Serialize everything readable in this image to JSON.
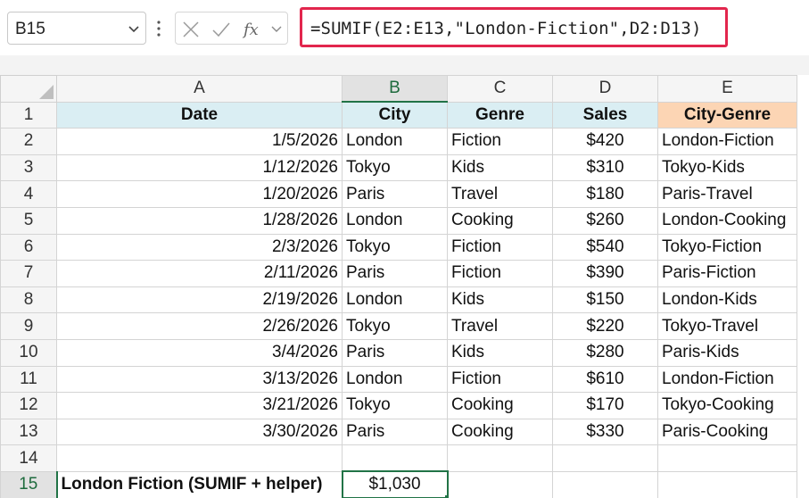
{
  "name_box": {
    "value": "B15"
  },
  "formula_bar": {
    "formula": "=SUMIF(E2:E13,\"London-Fiction\",D2:D13)",
    "highlight_color": "#e2264d",
    "icons": [
      "cancel-icon",
      "enter-check-icon",
      "fx-icon",
      "chevron-down-icon"
    ]
  },
  "columns": [
    "A",
    "B",
    "C",
    "D",
    "E"
  ],
  "active_column": "B",
  "rows": [
    "1",
    "2",
    "3",
    "4",
    "5",
    "6",
    "7",
    "8",
    "9",
    "10",
    "11",
    "12",
    "13",
    "14",
    "15"
  ],
  "active_row": "15",
  "headers": {
    "date": "Date",
    "city": "City",
    "genre": "Genre",
    "sales": "Sales",
    "city_genre": "City-Genre"
  },
  "data": [
    {
      "date": "1/5/2026",
      "city": "London",
      "genre": "Fiction",
      "sales": "$420",
      "city_genre": "London-Fiction"
    },
    {
      "date": "1/12/2026",
      "city": "Tokyo",
      "genre": "Kids",
      "sales": "$310",
      "city_genre": "Tokyo-Kids"
    },
    {
      "date": "1/20/2026",
      "city": "Paris",
      "genre": "Travel",
      "sales": "$180",
      "city_genre": "Paris-Travel"
    },
    {
      "date": "1/28/2026",
      "city": "London",
      "genre": "Cooking",
      "sales": "$260",
      "city_genre": "London-Cooking"
    },
    {
      "date": "2/3/2026",
      "city": "Tokyo",
      "genre": "Fiction",
      "sales": "$540",
      "city_genre": "Tokyo-Fiction"
    },
    {
      "date": "2/11/2026",
      "city": "Paris",
      "genre": "Fiction",
      "sales": "$390",
      "city_genre": "Paris-Fiction"
    },
    {
      "date": "2/19/2026",
      "city": "London",
      "genre": "Kids",
      "sales": "$150",
      "city_genre": "London-Kids"
    },
    {
      "date": "2/26/2026",
      "city": "Tokyo",
      "genre": "Travel",
      "sales": "$220",
      "city_genre": "Tokyo-Travel"
    },
    {
      "date": "3/4/2026",
      "city": "Paris",
      "genre": "Kids",
      "sales": "$280",
      "city_genre": "Paris-Kids"
    },
    {
      "date": "3/13/2026",
      "city": "London",
      "genre": "Fiction",
      "sales": "$610",
      "city_genre": "London-Fiction"
    },
    {
      "date": "3/21/2026",
      "city": "Tokyo",
      "genre": "Cooking",
      "sales": "$170",
      "city_genre": "Tokyo-Cooking"
    },
    {
      "date": "3/30/2026",
      "city": "Paris",
      "genre": "Cooking",
      "sales": "$330",
      "city_genre": "Paris-Cooking"
    }
  ],
  "summary": {
    "label": "London Fiction (SUMIF + helper)",
    "value": "$1,030"
  },
  "colors": {
    "header_blue": "#daeef3",
    "header_orange": "#fcd5b4",
    "selection_green": "#217346"
  }
}
